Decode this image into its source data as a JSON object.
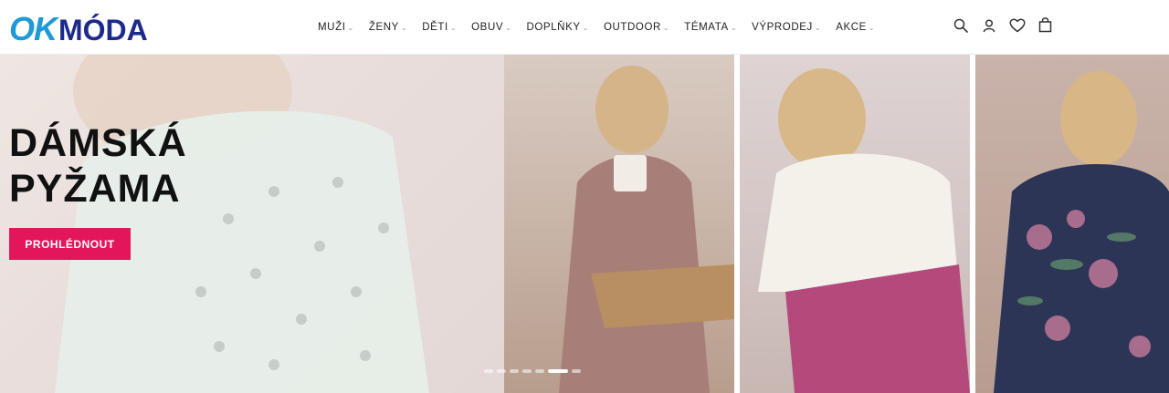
{
  "logo": {
    "part1": "OK",
    "part2": "MÓDA"
  },
  "nav": {
    "items": [
      {
        "label": "MUŽI"
      },
      {
        "label": "ŽENY"
      },
      {
        "label": "DĚTI"
      },
      {
        "label": "OBUV"
      },
      {
        "label": "DOPLŇKY"
      },
      {
        "label": "OUTDOOR"
      },
      {
        "label": "TÉMATA"
      },
      {
        "label": "VÝPRODEJ"
      },
      {
        "label": "AKCE"
      }
    ]
  },
  "header_icons": [
    "search-icon",
    "user-icon",
    "heart-icon",
    "bag-icon"
  ],
  "hero": {
    "title_line1": "DÁMSKÁ",
    "title_line2": "PYŽAMA",
    "cta_label": "PROHLÉDNOUT",
    "slides_count": 7,
    "active_slide": 5
  },
  "colors": {
    "brand_blue": "#1e9ad6",
    "brand_navy": "#1d2a8a",
    "cta": "#e3165b"
  }
}
